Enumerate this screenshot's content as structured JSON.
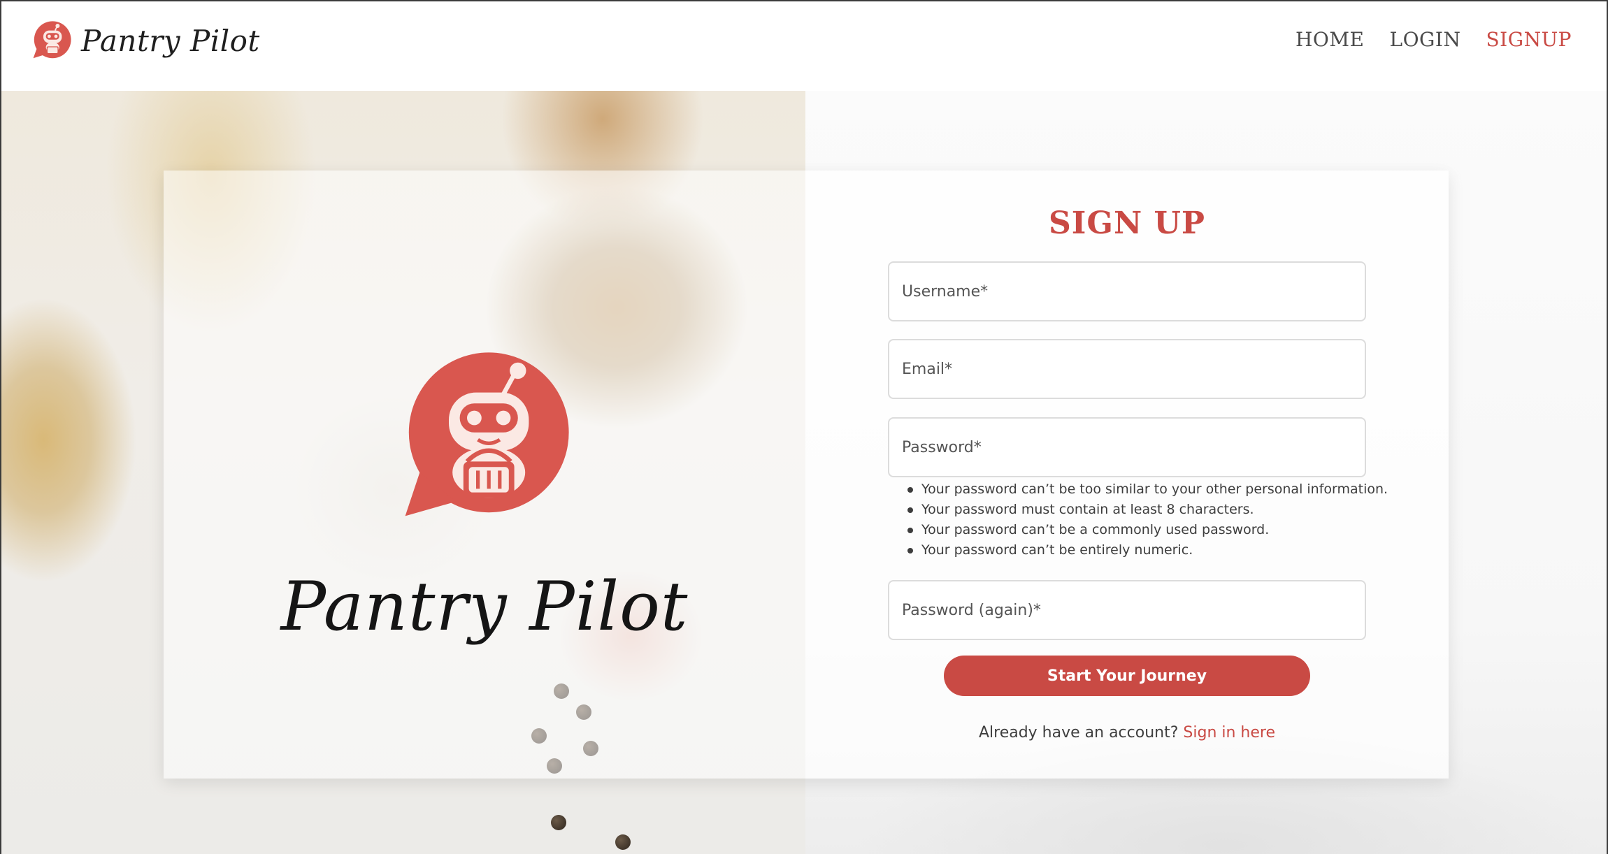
{
  "brand": {
    "name": "Pantry Pilot",
    "logo_icon": "robot-basket-logo-icon",
    "accent": "#c94a44"
  },
  "nav": {
    "items": [
      {
        "label": "HOME",
        "active": false
      },
      {
        "label": "LOGIN",
        "active": false
      },
      {
        "label": "SIGNUP",
        "active": true
      }
    ]
  },
  "hero": {
    "name": "Pantry Pilot"
  },
  "form": {
    "title": "SIGN UP",
    "fields": {
      "username": {
        "placeholder": "Username*",
        "value": ""
      },
      "email": {
        "placeholder": "Email*",
        "value": ""
      },
      "password": {
        "placeholder": "Password*",
        "value": ""
      },
      "password2": {
        "placeholder": "Password (again)*",
        "value": ""
      }
    },
    "password_help": [
      "Your password can’t be too similar to your other personal information.",
      "Your password must contain at least 8 characters.",
      "Your password can’t be a commonly used password.",
      "Your password can’t be entirely numeric."
    ],
    "submit_label": "Start Your Journey",
    "signin_prompt": "Already have an account?",
    "signin_link": "Sign in here"
  }
}
